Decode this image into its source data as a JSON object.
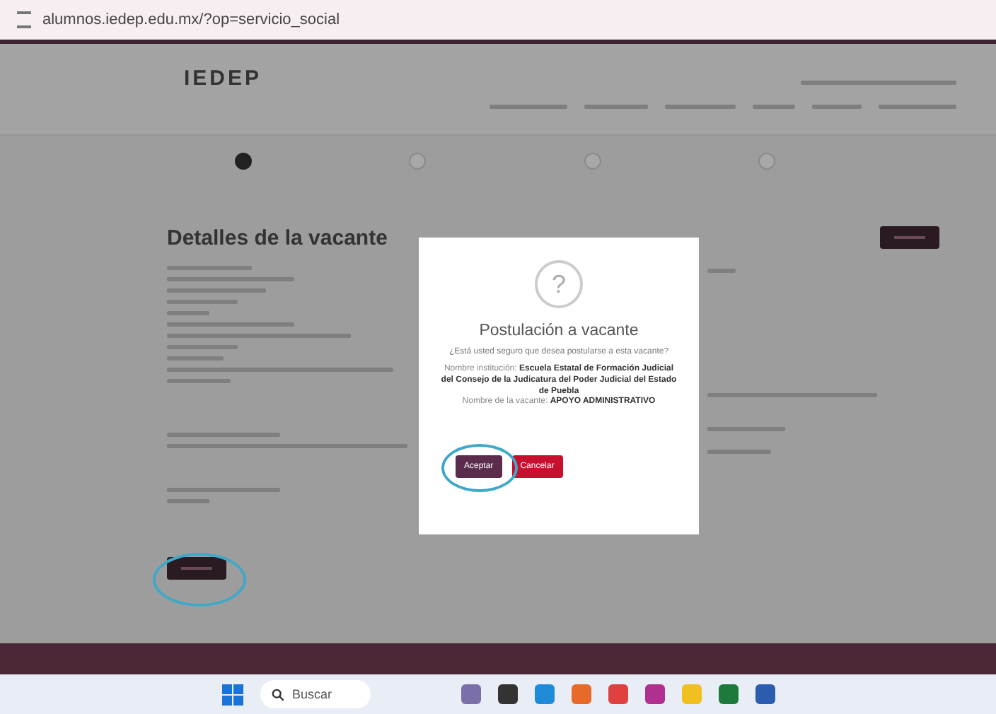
{
  "browser": {
    "url": "alumnos.iedep.edu.mx/?op=servicio_social"
  },
  "header": {
    "logo": "IEDEP"
  },
  "stepper": [
    {
      "selected": true
    },
    {
      "selected": false
    },
    {
      "selected": false
    },
    {
      "selected": false
    }
  ],
  "page_title": "Detalles de la vacante",
  "modal": {
    "icon": "?",
    "title": "Postulación a vacante",
    "question": "¿Está usted seguro que desea postularse a esta vacante?",
    "details": [
      "Nombre institución: **Escuela Estatal de Formación Judicial del Consejo de la Judicatura del Poder Judicial del Estado de Puebla**",
      "Nombre de la vacante: **APOYO ADMINISTRATIVO**"
    ],
    "buttons": [
      {
        "label": "Aceptar",
        "kind": "confirm"
      },
      {
        "label": "Cancelar",
        "kind": "cancel"
      }
    ]
  },
  "taskbar": {
    "search_placeholder": "Buscar"
  }
}
